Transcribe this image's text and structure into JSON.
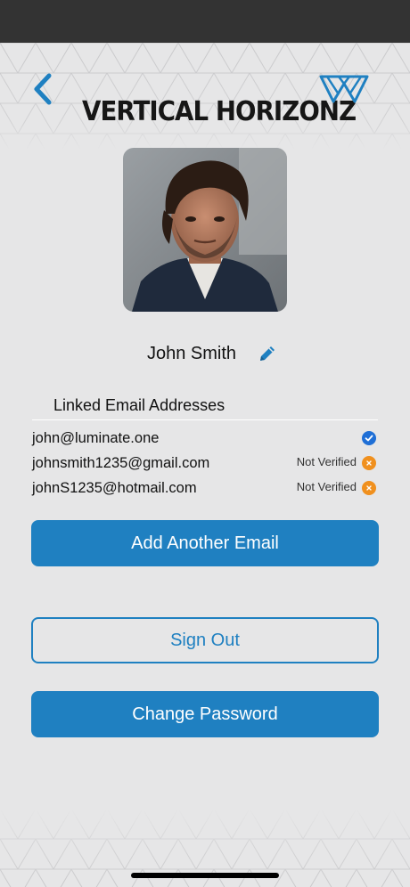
{
  "header": {
    "logo_text": "VERTICAL HORIZONZ",
    "back_icon": "chevron-left-icon",
    "logo_icon": "vh-logo-icon"
  },
  "profile": {
    "name": "John Smith",
    "avatar_icon": "profile-photo",
    "edit_icon": "pencil-icon"
  },
  "emails": {
    "title": "Linked Email Addresses",
    "items": [
      {
        "address": "john@luminate.one",
        "status": "",
        "status_icon": "check-circle-icon"
      },
      {
        "address": "johnsmith1235@gmail.com",
        "status": "Not Verified",
        "status_icon": "x-circle-icon"
      },
      {
        "address": "johnS1235@hotmail.com",
        "status": "Not Verified",
        "status_icon": "x-circle-icon"
      }
    ]
  },
  "actions": {
    "add_email": "Add Another Email",
    "sign_out": "Sign Out",
    "change_password": "Change Password"
  },
  "colors": {
    "accent": "#1f80c1",
    "verified": "#1f6fd6",
    "not_verified": "#f0901e",
    "background": "#e6e6e7",
    "status_bar": "#333333"
  }
}
